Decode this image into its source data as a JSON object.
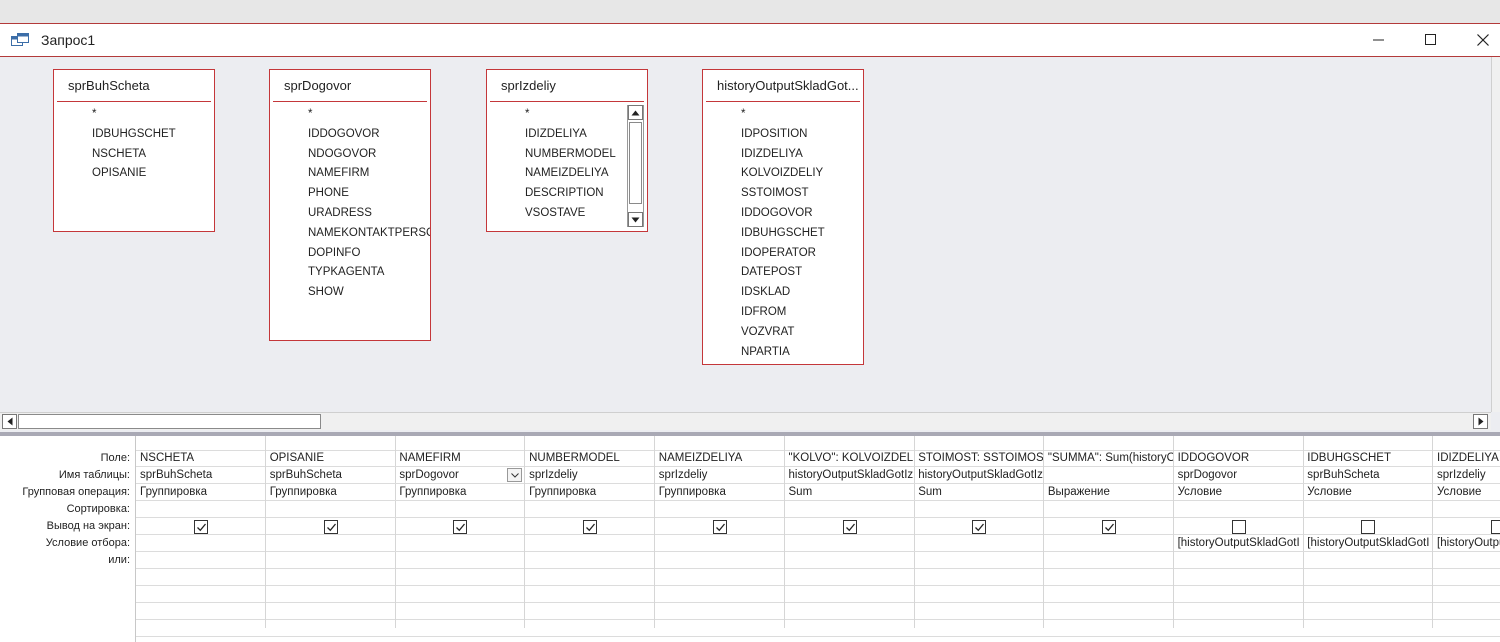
{
  "window": {
    "title": "Запрос1",
    "icons": {
      "app": "query-design-icon",
      "minimize": "minimize-icon",
      "maximize": "maximize-icon",
      "close": "close-icon"
    }
  },
  "tables": [
    {
      "name": "sprBuhScheta",
      "fields": [
        "*",
        "IDBUHGSCHET",
        "NSCHETA",
        "OPISANIE"
      ]
    },
    {
      "name": "sprDogovor",
      "fields": [
        "*",
        "IDDOGOVOR",
        "NDOGOVOR",
        "NAMEFIRM",
        "PHONE",
        "URADRESS",
        "NAMEKONTAKTPERSC",
        "DOPINFO",
        "TYPKAGENTA",
        "SHOW"
      ]
    },
    {
      "name": "sprIzdeliy",
      "fields": [
        "*",
        "IDIZDELIYA",
        "NUMBERMODEL",
        "NAMEIZDELIYA",
        "DESCRIPTION",
        "VSOSTAVE"
      ]
    },
    {
      "name": "historyOutputSkladGot...",
      "fields": [
        "*",
        "IDPOSITION",
        "IDIZDELIYA",
        "KOLVOIZDELIY",
        "SSTOIMOST",
        "IDDOGOVOR",
        "IDBUHGSCHET",
        "IDOPERATOR",
        "DATEPOST",
        "IDSKLAD",
        "IDFROM",
        "VOZVRAT",
        "NPARTIA"
      ]
    }
  ],
  "grid": {
    "row_labels": [
      "Поле:",
      "Имя таблицы:",
      "Групповая операция:",
      "Сортировка:",
      "Вывод на экран:",
      "Условие отбора:",
      "или:"
    ],
    "columns": [
      {
        "field": "NSCHETA",
        "table": "sprBuhScheta",
        "total": "Группировка",
        "sort": "",
        "show": true,
        "criteria": ""
      },
      {
        "field": "OPISANIE",
        "table": "sprBuhScheta",
        "total": "Группировка",
        "sort": "",
        "show": true,
        "criteria": ""
      },
      {
        "field": "NAMEFIRM",
        "table": "sprDogovor",
        "total": "Группировка",
        "sort": "",
        "show": true,
        "criteria": ""
      },
      {
        "field": "NUMBERMODEL",
        "table": "sprIzdeliy",
        "total": "Группировка",
        "sort": "",
        "show": true,
        "criteria": ""
      },
      {
        "field": "NAMEIZDELIYA",
        "table": "sprIzdeliy",
        "total": "Группировка",
        "sort": "",
        "show": true,
        "criteria": ""
      },
      {
        "field": "\"KOLVO\": KOLVOIZDELIY",
        "table": "historyOutputSkladGotIz",
        "total": "Sum",
        "sort": "",
        "show": true,
        "criteria": ""
      },
      {
        "field": "STOIMOST: SSTOIMOST",
        "table": "historyOutputSkladGotIz",
        "total": "Sum",
        "sort": "",
        "show": true,
        "criteria": ""
      },
      {
        "field": "\"SUMMA\": Sum(historyO",
        "table": "",
        "total": "Выражение",
        "sort": "",
        "show": true,
        "criteria": ""
      },
      {
        "field": "IDDOGOVOR",
        "table": "sprDogovor",
        "total": "Условие",
        "sort": "",
        "show": false,
        "criteria": "[historyOutputSkladGotI"
      },
      {
        "field": "IDBUHGSCHET",
        "table": "sprBuhScheta",
        "total": "Условие",
        "sort": "",
        "show": false,
        "criteria": "[historyOutputSkladGotI"
      },
      {
        "field": "IDIZDELIYA",
        "table": "sprIzdeliy",
        "total": "Условие",
        "sort": "",
        "show": false,
        "criteria": "[historyOutpu"
      }
    ]
  }
}
